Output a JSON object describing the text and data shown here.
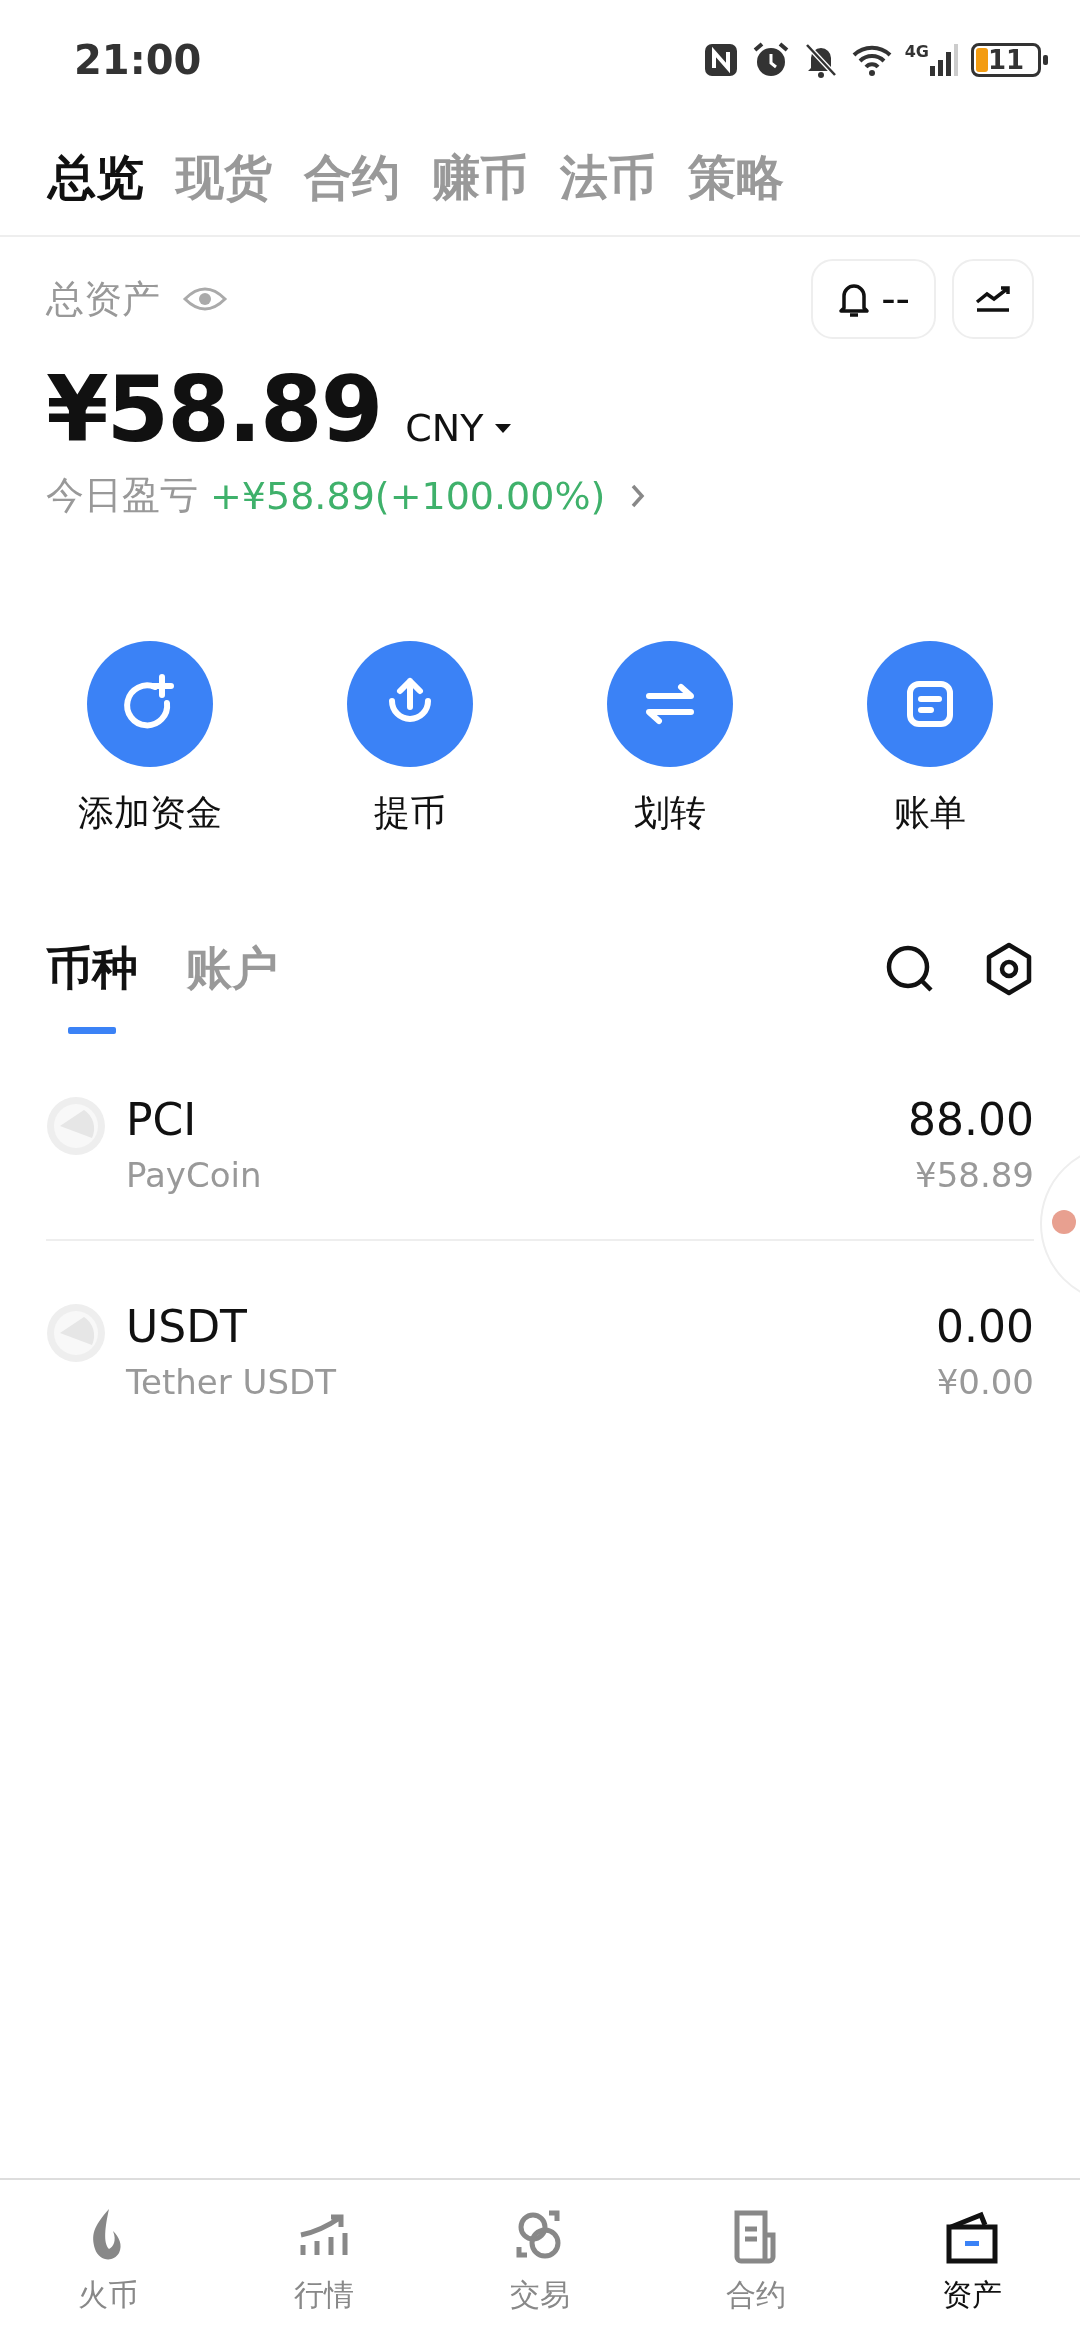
{
  "status_bar": {
    "time": "21:00",
    "network": "4G",
    "battery": "11"
  },
  "top_tabs": [
    {
      "label": "总览",
      "selected": true
    },
    {
      "label": "现货",
      "selected": false
    },
    {
      "label": "合约",
      "selected": false
    },
    {
      "label": "赚币",
      "selected": false
    },
    {
      "label": "法币",
      "selected": false
    },
    {
      "label": "策略",
      "selected": false
    }
  ],
  "summary": {
    "label": "总资产",
    "alert": "--",
    "amount": "¥58.89",
    "currency": "CNY",
    "pnl_label": "今日盈亏",
    "pnl_value": "+¥58.89(+100.00%)"
  },
  "actions": [
    {
      "kind": "deposit",
      "label": "添加资金"
    },
    {
      "kind": "withdraw",
      "label": "提币"
    },
    {
      "kind": "transfer",
      "label": "划转"
    },
    {
      "kind": "bill",
      "label": "账单"
    }
  ],
  "list_tabs": [
    {
      "label": "币种",
      "selected": true
    },
    {
      "label": "账户",
      "selected": false
    }
  ],
  "coins": [
    {
      "symbol": "PCI",
      "name": "PayCoin",
      "amount": "88.00",
      "value": "¥58.89"
    },
    {
      "symbol": "USDT",
      "name": "Tether USDT",
      "amount": "0.00",
      "value": "¥0.00"
    }
  ],
  "bottom_nav": [
    {
      "kind": "flame",
      "label": "火币",
      "selected": false
    },
    {
      "kind": "market",
      "label": "行情",
      "selected": false
    },
    {
      "kind": "trade",
      "label": "交易",
      "selected": false
    },
    {
      "kind": "contract",
      "label": "合约",
      "selected": false
    },
    {
      "kind": "wallet",
      "label": "资产",
      "selected": true
    }
  ]
}
